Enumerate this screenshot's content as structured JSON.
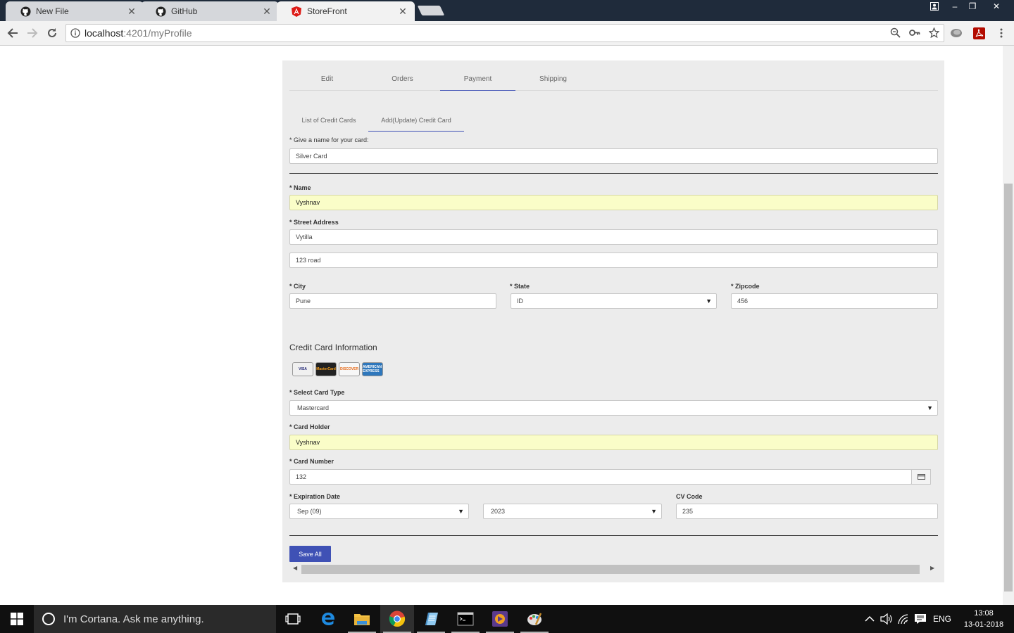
{
  "browser": {
    "tabs": [
      {
        "label": "New File",
        "icon": "github-icon",
        "active": false
      },
      {
        "label": "GitHub",
        "icon": "github-icon",
        "active": false
      },
      {
        "label": "StoreFront",
        "icon": "angular-icon",
        "active": true
      }
    ],
    "close_glyph": "✕",
    "window_controls": {
      "minimize": "–",
      "restore": "❐",
      "close": "✕"
    },
    "url_host": "localhost",
    "url_rest": ":4201/myProfile"
  },
  "profile": {
    "main_tabs": [
      "Edit",
      "Orders",
      "Payment",
      "Shipping"
    ],
    "active_main_tab": "Payment",
    "sub_tabs": [
      "List of Credit Cards",
      "Add(Update) Credit Card"
    ],
    "active_sub_tab": "Add(Update) Credit Card",
    "card_name_label": "* Give a name for your card:",
    "card_name_value": "Silver Card",
    "name_label": "* Name",
    "name_value": "Vyshnav",
    "street_label": "* Street Address",
    "street1_value": "Vytilla",
    "street2_value": "123 road",
    "city_label": "* City",
    "city_value": "Pune",
    "state_label": "* State",
    "state_value": "ID",
    "zip_label": "* Zipcode",
    "zip_value": "456",
    "cc_section_title": "Credit Card Information",
    "card_logos": [
      {
        "text": "VISA",
        "bg": "#f0f0f0",
        "fg": "#1a1f71"
      },
      {
        "text": "MasterCard",
        "bg": "#222222",
        "fg": "#f79e1b"
      },
      {
        "text": "DISCOVER",
        "bg": "#f7f7f7",
        "fg": "#e66b1a"
      },
      {
        "text": "AMERICAN EXPRESS",
        "bg": "#2e77bc",
        "fg": "#ffffff"
      }
    ],
    "card_type_label": "* Select Card Type",
    "card_type_value": "Mastercard",
    "card_holder_label": "* Card Holder",
    "card_holder_value": "Vyshnav",
    "card_number_label": "* Card Number",
    "card_number_value": "132",
    "expiration_label": "* Expiration Date",
    "exp_month_value": "Sep (09)",
    "exp_year_value": "2023",
    "cv_label": "CV Code",
    "cv_value": "235",
    "save_label": "Save All"
  },
  "taskbar": {
    "cortana_text": "I'm Cortana. Ask me anything.",
    "lang": "ENG",
    "time": "13:08",
    "date": "13-01-2018"
  },
  "colors": {
    "accent": "#3f51b5",
    "autofill": "#fafdc8",
    "panel": "#ececec",
    "tabstrip": "#1f2b3b"
  }
}
